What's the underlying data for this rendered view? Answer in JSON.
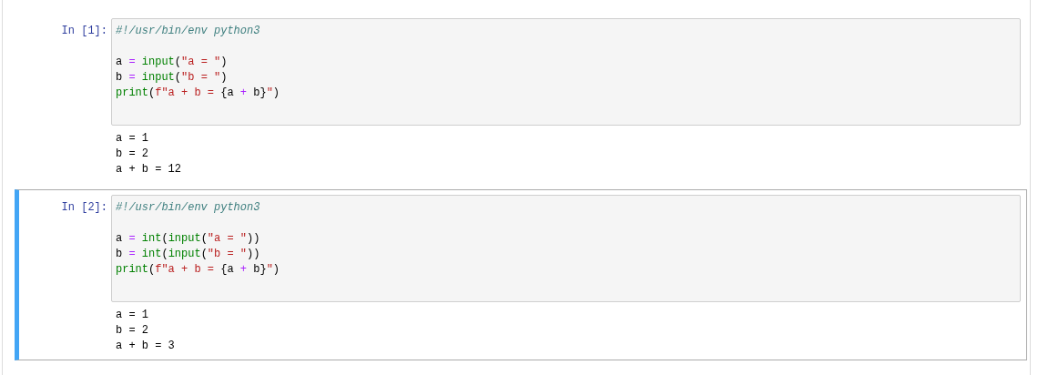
{
  "cells": [
    {
      "prompt": "In [1]:",
      "selected": false,
      "code": [
        {
          "kind": "code",
          "tokens": [
            {
              "text": "#!/usr/bin/env python3",
              "kind": "comment"
            }
          ]
        },
        {
          "kind": "blank"
        },
        {
          "kind": "code",
          "tokens": [
            {
              "text": "a ",
              "kind": "plain"
            },
            {
              "text": "= ",
              "kind": "operator"
            },
            {
              "text": "input",
              "kind": "builtin"
            },
            {
              "text": "(",
              "kind": "plain"
            },
            {
              "text": "\"a = \"",
              "kind": "string"
            },
            {
              "text": ")",
              "kind": "plain"
            }
          ]
        },
        {
          "kind": "code",
          "tokens": [
            {
              "text": "b ",
              "kind": "plain"
            },
            {
              "text": "= ",
              "kind": "operator"
            },
            {
              "text": "input",
              "kind": "builtin"
            },
            {
              "text": "(",
              "kind": "plain"
            },
            {
              "text": "\"b = \"",
              "kind": "string"
            },
            {
              "text": ")",
              "kind": "plain"
            }
          ]
        },
        {
          "kind": "code",
          "tokens": [
            {
              "text": "print",
              "kind": "builtin"
            },
            {
              "text": "(",
              "kind": "plain"
            },
            {
              "text": "f\"a + b = ",
              "kind": "string"
            },
            {
              "text": "{a ",
              "kind": "plain"
            },
            {
              "text": "+",
              "kind": "operator"
            },
            {
              "text": " b}",
              "kind": "plain"
            },
            {
              "text": "\"",
              "kind": "string"
            },
            {
              "text": ")",
              "kind": "plain"
            }
          ]
        }
      ],
      "output": [
        "a = 1",
        "b = 2",
        "a + b = 12"
      ]
    },
    {
      "prompt": "In [2]:",
      "selected": true,
      "code": [
        {
          "kind": "code",
          "tokens": [
            {
              "text": "#!/usr/bin/env python3",
              "kind": "comment"
            }
          ]
        },
        {
          "kind": "blank"
        },
        {
          "kind": "code",
          "tokens": [
            {
              "text": "a ",
              "kind": "plain"
            },
            {
              "text": "= ",
              "kind": "operator"
            },
            {
              "text": "int",
              "kind": "builtin"
            },
            {
              "text": "(",
              "kind": "plain"
            },
            {
              "text": "input",
              "kind": "builtin"
            },
            {
              "text": "(",
              "kind": "plain"
            },
            {
              "text": "\"a = \"",
              "kind": "string"
            },
            {
              "text": "))",
              "kind": "plain"
            }
          ]
        },
        {
          "kind": "code",
          "tokens": [
            {
              "text": "b ",
              "kind": "plain"
            },
            {
              "text": "= ",
              "kind": "operator"
            },
            {
              "text": "int",
              "kind": "builtin"
            },
            {
              "text": "(",
              "kind": "plain"
            },
            {
              "text": "input",
              "kind": "builtin"
            },
            {
              "text": "(",
              "kind": "plain"
            },
            {
              "text": "\"b = \"",
              "kind": "string"
            },
            {
              "text": "))",
              "kind": "plain"
            }
          ]
        },
        {
          "kind": "code",
          "tokens": [
            {
              "text": "print",
              "kind": "builtin"
            },
            {
              "text": "(",
              "kind": "plain"
            },
            {
              "text": "f\"a + b = ",
              "kind": "string"
            },
            {
              "text": "{a ",
              "kind": "plain"
            },
            {
              "text": "+",
              "kind": "operator"
            },
            {
              "text": " b}",
              "kind": "plain"
            },
            {
              "text": "\"",
              "kind": "string"
            },
            {
              "text": ")",
              "kind": "plain"
            }
          ]
        }
      ],
      "output": [
        "a = 1",
        "b = 2",
        "a + b = 3"
      ]
    }
  ]
}
